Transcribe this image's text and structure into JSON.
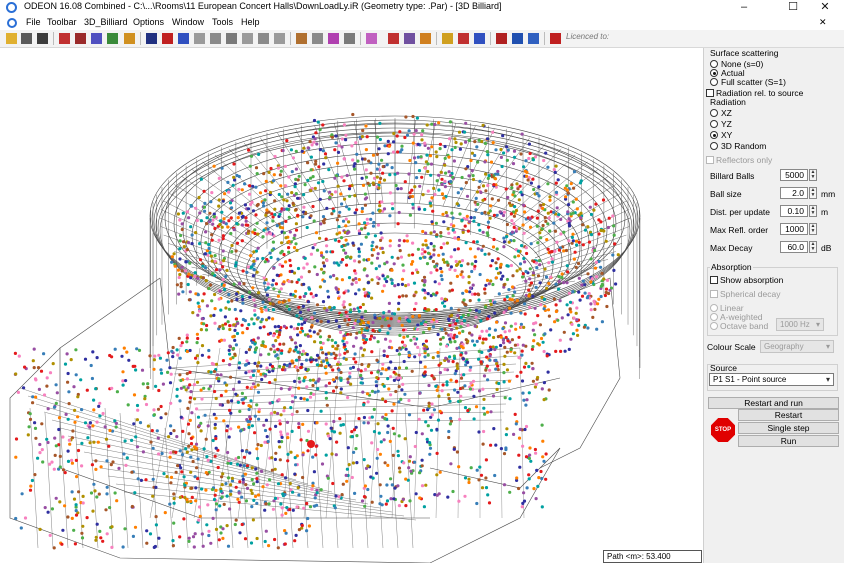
{
  "window": {
    "title": "ODEON 16.08 Combined  -  C:\\...\\Rooms\\11 European Concert Halls\\DownLoadLy.iR      (Geometry type: .Par) - [3D Billiard]",
    "minimize": "–",
    "maximize": "☐",
    "close": "✕",
    "close_inner": "✕"
  },
  "menu": [
    "File",
    "Toolbar",
    "3D_Billiard",
    "Options",
    "Window",
    "Tools",
    "Help"
  ],
  "toolbar": {
    "licence_text": "Licenced to:"
  },
  "panel": {
    "surface_scattering_label": "Surface scattering",
    "surface_options": [
      "None (s=0)",
      "Actual",
      "Full scatter (S=1)"
    ],
    "surface_selected": 1,
    "radiation_rel_label": "Radiation rel. to source",
    "radiation_label": "Radiation",
    "radiation_options": [
      "XZ",
      "YZ",
      "XY",
      "3D Random"
    ],
    "radiation_selected": 2,
    "reflectors_only": "Reflectors only",
    "params": [
      {
        "label": "Billard Balls",
        "value": "5000",
        "unit": ""
      },
      {
        "label": "Ball size",
        "value": "2.0",
        "unit": "mm"
      },
      {
        "label": "Dist. per update",
        "value": "0.10",
        "unit": "m"
      },
      {
        "label": "Max Refl. order",
        "value": "1000",
        "unit": ""
      },
      {
        "label": "Max Decay",
        "value": "60.0",
        "unit": "dB"
      }
    ],
    "absorption_label": "Absorption",
    "show_absorption": "Show absorption",
    "spherical_decay": "Spherical decay",
    "weighting_options": [
      "Linear",
      "A-weighted",
      "Octave band"
    ],
    "octave_band_value": "1000 Hz",
    "colour_scale_label": "Colour Scale",
    "colour_scale_value": "Geography",
    "source_label": "Source",
    "source_value": "P1 S1  -  Point source",
    "restart_and_run": "Restart and run",
    "restart": "Restart",
    "single_step": "Single step",
    "run": "Run",
    "stop": "STOP"
  },
  "status": {
    "path_text": "Path <m>: 53.400"
  },
  "colors": {
    "dots": [
      "#e41a1c",
      "#377eb8",
      "#4daf4a",
      "#984ea3",
      "#ff7f00",
      "#a65628",
      "#f781bf",
      "#2f2fa0",
      "#00a0a0",
      "#b09000"
    ],
    "wire": "#4a4a4a"
  }
}
